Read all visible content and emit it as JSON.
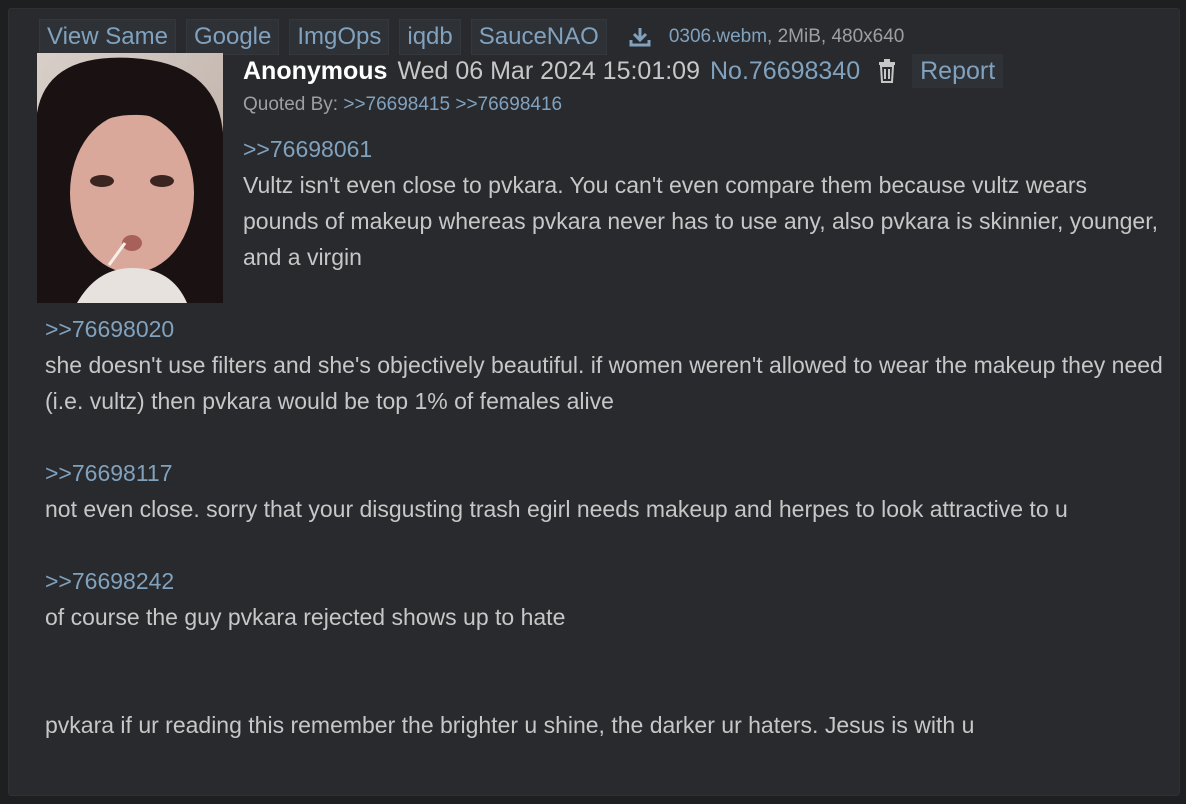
{
  "toolbar": {
    "buttons": [
      "View Same",
      "Google",
      "ImgOps",
      "iqdb",
      "SauceNAO"
    ],
    "download_icon": "download-icon",
    "file_name": "0306.webm",
    "file_meta": ", 2MiB, 480x640"
  },
  "post": {
    "name": "Anonymous",
    "date": "Wed 06 Mar 2024 15:01:09",
    "number": "No.76698340",
    "delete_icon": "trash-icon",
    "report_label": "Report",
    "quoted_by_label": "Quoted By:",
    "quoted_by": [
      ">>76698415",
      ">>76698416"
    ],
    "sections": [
      {
        "quote": ">>76698061",
        "text": "Vultz isn't even close to pvkara. You can't even compare them because vultz wears pounds of makeup whereas pvkara never has to use any, also pvkara is skinnier, younger, and a virgin"
      },
      {
        "quote": ">>76698020",
        "text": "she doesn't use filters and she's objectively beautiful. if women weren't allowed to wear the makeup they need (i.e. vultz) then pvkara would be top 1% of females alive"
      },
      {
        "quote": ">>76698117",
        "text": "not even close. sorry that your disgusting trash egirl needs makeup and herpes to look attractive to u"
      },
      {
        "quote": ">>76698242",
        "text": "of course the guy pvkara rejected shows up to hate"
      }
    ],
    "closing": "pvkara if ur reading this remember the brighter u shine, the darker ur haters. Jesus is with u"
  },
  "colors": {
    "background": "#1d1f21",
    "post_bg": "#282a2e",
    "link": "#81a2be",
    "text": "#c5c8c6",
    "name": "#ffffff"
  }
}
